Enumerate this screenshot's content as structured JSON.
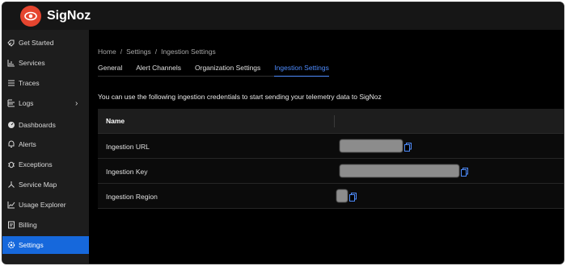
{
  "app": {
    "name": "SigNoz"
  },
  "sidebar": {
    "items": [
      {
        "label": "Get Started",
        "icon": "rocket-icon"
      },
      {
        "label": "Services",
        "icon": "bar-chart-icon"
      },
      {
        "label": "Traces",
        "icon": "list-icon"
      },
      {
        "label": "Logs",
        "icon": "file-lines-icon"
      },
      {
        "label": "Dashboards",
        "icon": "dashboard-icon"
      },
      {
        "label": "Alerts",
        "icon": "bell-icon"
      },
      {
        "label": "Exceptions",
        "icon": "bug-icon"
      },
      {
        "label": "Service Map",
        "icon": "network-icon"
      },
      {
        "label": "Usage Explorer",
        "icon": "line-chart-icon"
      },
      {
        "label": "Billing",
        "icon": "credit-card-icon"
      },
      {
        "label": "Settings",
        "icon": "gear-icon"
      }
    ],
    "active": "Settings"
  },
  "breadcrumb": {
    "home": "Home",
    "settings": "Settings",
    "current": "Ingestion Settings",
    "sep": "/"
  },
  "tabs": [
    "General",
    "Alert Channels",
    "Organization Settings",
    "Ingestion Settings"
  ],
  "active_tab": "Ingestion Settings",
  "description": "You can use the following ingestion credentials to start sending your telemetry data to SigNoz",
  "table": {
    "header": "Name",
    "rows": [
      {
        "name": "Ingestion URL"
      },
      {
        "name": "Ingestion Key"
      },
      {
        "name": "Ingestion Region"
      }
    ]
  },
  "colors": {
    "accent": "#1668dc",
    "tab_active": "#4e8cff",
    "brand": "#e5452f"
  }
}
